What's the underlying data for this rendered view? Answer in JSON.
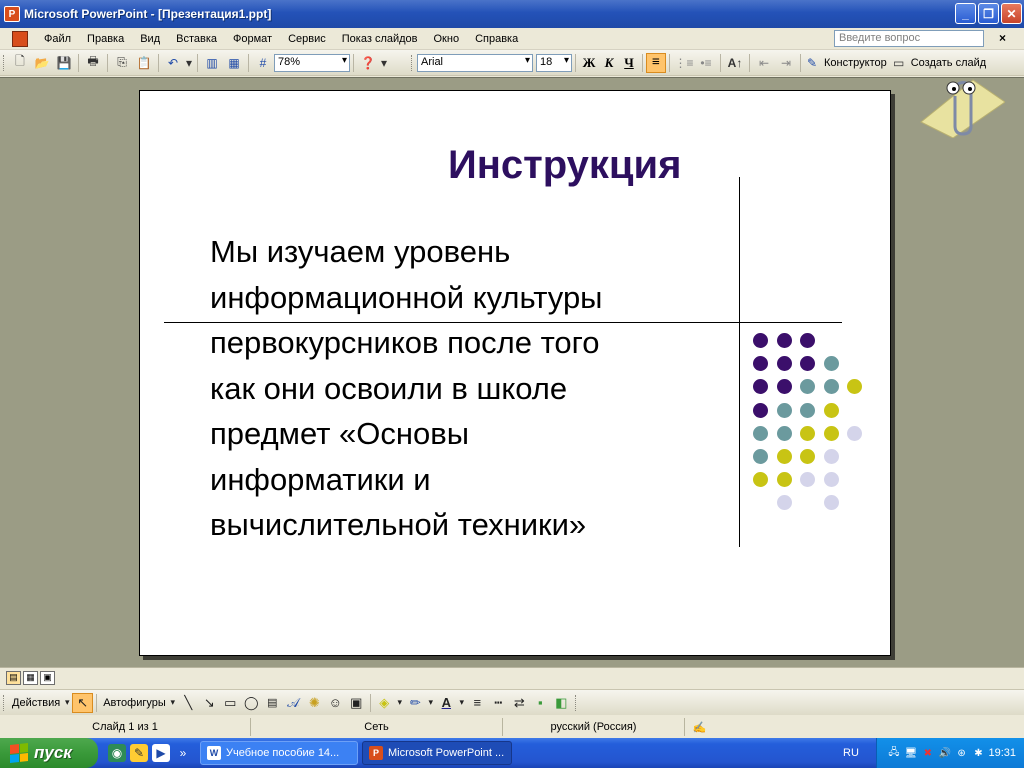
{
  "window": {
    "title": "Microsoft PowerPoint - [Презентация1.ppt]",
    "app_icon_letter": "P",
    "controls": {
      "minimize": "_",
      "restore": "❐",
      "close": "✕"
    }
  },
  "menu": {
    "items": [
      "Файл",
      "Правка",
      "Вид",
      "Вставка",
      "Формат",
      "Сервис",
      "Показ слайдов",
      "Окно",
      "Справка"
    ],
    "help_placeholder": "Введите вопрос",
    "close": "×"
  },
  "toolbar": {
    "zoom": "78%",
    "font": "Arial",
    "size": "18",
    "bold": "Ж",
    "italic": "К",
    "underline": "Ч",
    "designer_label": "Конструктор",
    "new_slide_label": "Создать слайд"
  },
  "slide": {
    "title": "Инструкция",
    "body_lines": [
      "Мы изучаем уровень",
      "информационной культуры",
      "первокурсников после того",
      "как они освоили в школе",
      "предмет «Основы",
      "информатики и",
      "вычислительной техники»"
    ],
    "dot_colors": {
      "purple": "#3b0f6b",
      "teal": "#6b9a9e",
      "yellow": "#c8c414",
      "lavender": "#d4d4ea"
    }
  },
  "drawing": {
    "actions_label": "Действия",
    "autoshapes_label": "Автофигуры"
  },
  "status": {
    "slide": "Слайд 1 из 1",
    "design": "Сеть",
    "language": "русский (Россия)"
  },
  "taskbar": {
    "start_label": "пуск",
    "tasks": [
      {
        "label": "Учебное пособие 14...",
        "icon": "W"
      },
      {
        "label": "Microsoft PowerPoint ...",
        "icon": "P"
      }
    ],
    "lang_indicator": "RU",
    "clock": "19:31"
  }
}
